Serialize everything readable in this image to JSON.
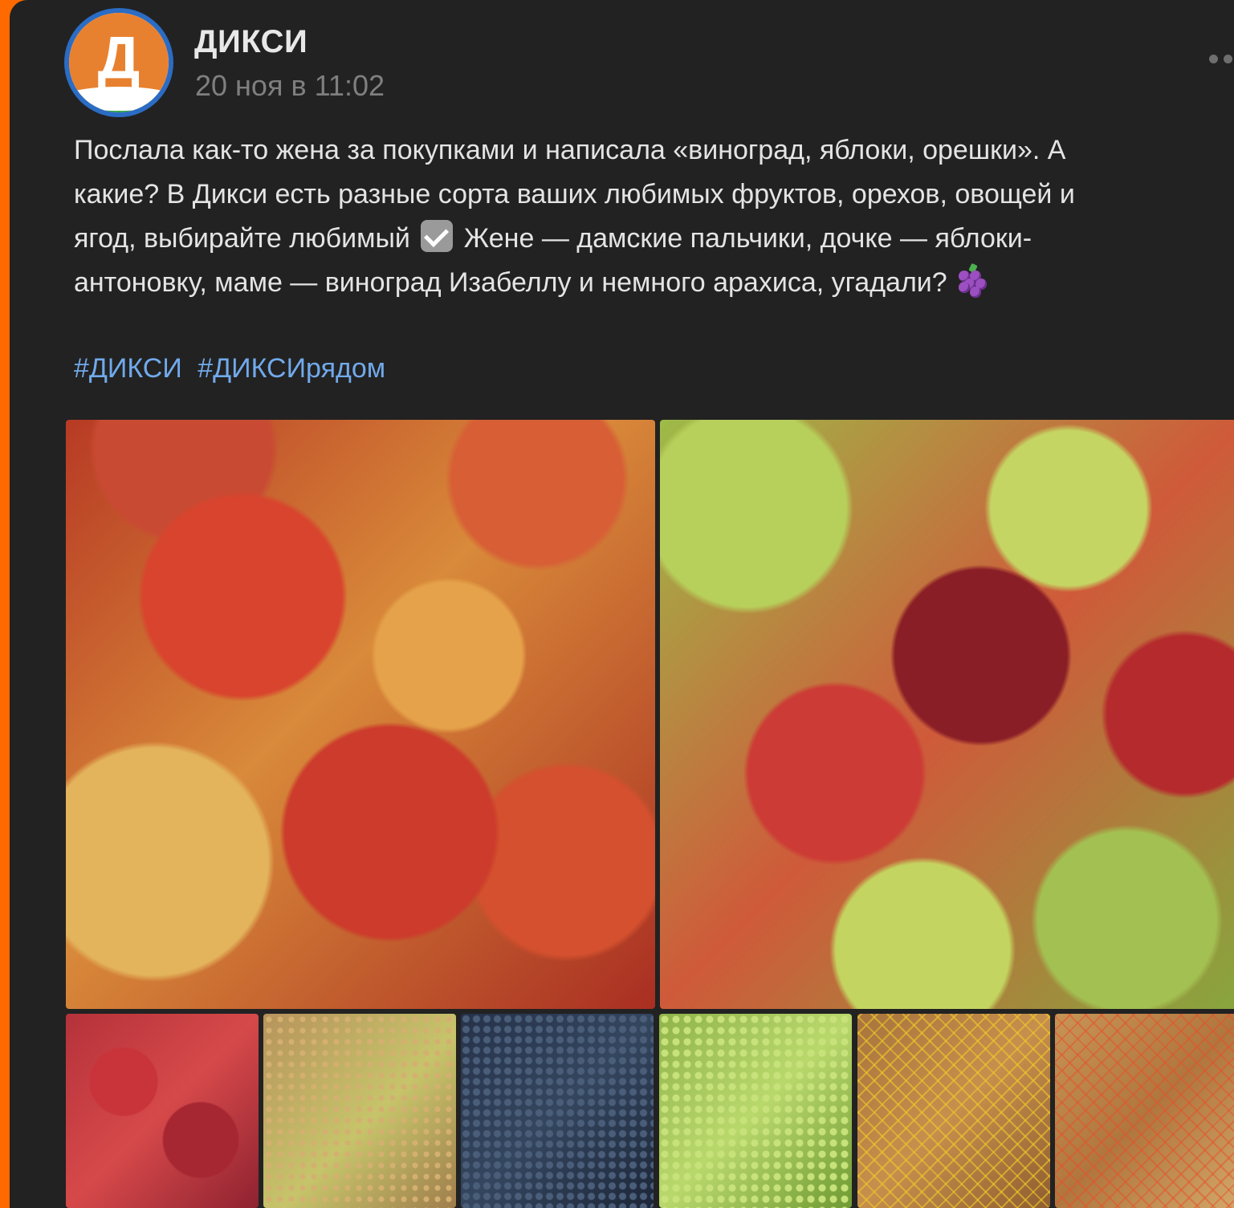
{
  "post": {
    "author": "ДИКСИ",
    "avatar_letter": "Д",
    "date": "20 ноя в 11:02",
    "text_lines": [
      "Послала как-то жена за покупками и написала «виноград, яблоки, орешки». А",
      "какие? В Дикси есть разные сорта ваших любимых фруктов, орехов, овощей и",
      "ягод, выбирайте любимый",
      "Жене — дамские пальчики, дочке — яблоки-",
      "антоновку, маме — виноград Изабеллу и немного арахиса, угадали?"
    ],
    "hashtags": [
      "#ДИКСИ",
      "#ДИКСИрядом"
    ],
    "icons": {
      "more": "more-horizontal-icon",
      "check": "check-box-icon",
      "grapes": "grapes-emoji-icon"
    },
    "photos": [
      {
        "name": "photo-red-apples"
      },
      {
        "name": "photo-mixed-apples"
      },
      {
        "name": "thumb-red-apples"
      },
      {
        "name": "thumb-lady-finger-grapes"
      },
      {
        "name": "thumb-isabella-grapes"
      },
      {
        "name": "thumb-green-grapes"
      },
      {
        "name": "thumb-nuts-net"
      },
      {
        "name": "thumb-peanuts-net"
      }
    ]
  },
  "colors": {
    "background": "#222222",
    "frame_accent": "#ff6a00",
    "text": "#e4e4e4",
    "muted": "#7f7f7f",
    "link": "#71aaeb"
  }
}
